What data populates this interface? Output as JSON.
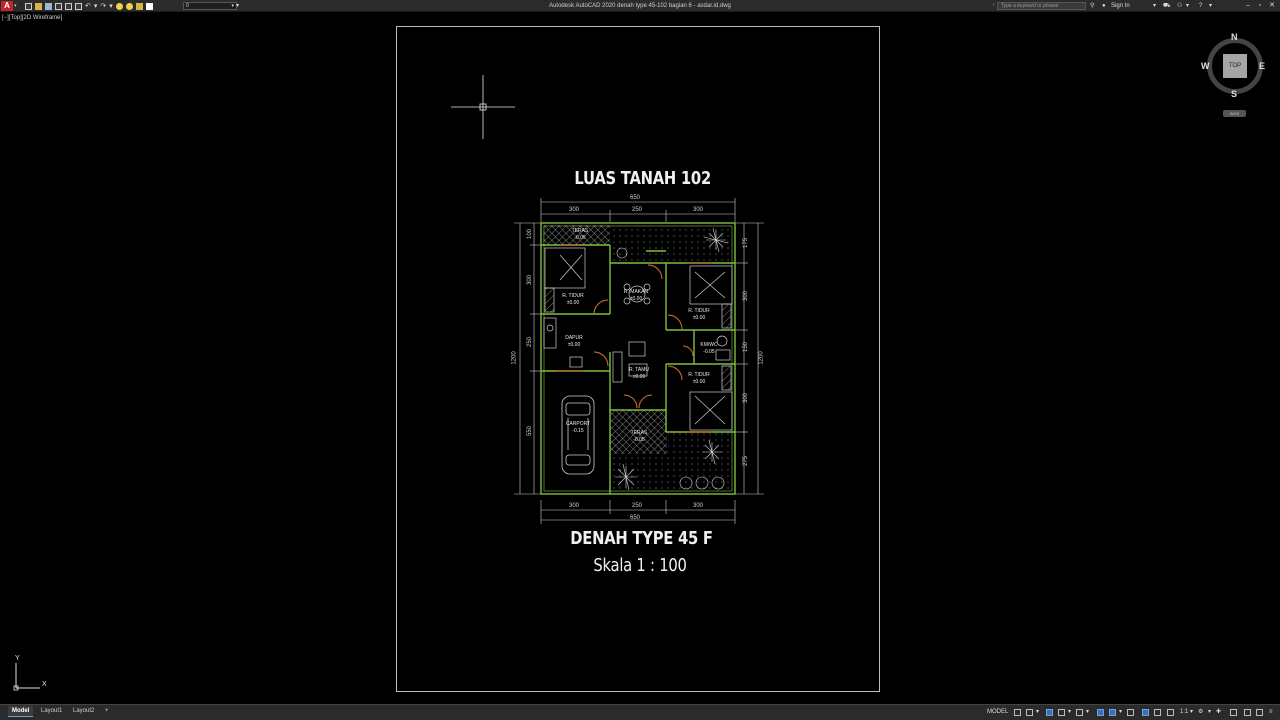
{
  "app": {
    "window_title": "Autodesk AutoCAD 2020    denah type 45-102 bagian 6 - asdar.id.dwg",
    "logo_letter": "A",
    "layer_combo": "0",
    "search_placeholder": "Type a keyword or phrase",
    "sign_in": "Sign In"
  },
  "viewport": {
    "label": "[−][Top][2D Wireframe]"
  },
  "drawing": {
    "top_title": "LUAS TANAH 102",
    "plan_title": "DENAH TYPE 45 F",
    "scale": "Skala 1 : 100",
    "dims_top_total": "650",
    "dims_top": [
      "300",
      "250",
      "300"
    ],
    "dims_bottom": [
      "300",
      "250",
      "300"
    ],
    "dims_bottom_total": "650",
    "dims_left": [
      "100",
      "300",
      "250",
      "550"
    ],
    "dims_left_total": "1200",
    "dims_right": [
      "175",
      "300",
      "150",
      "300",
      "275"
    ],
    "dims_right_total": "1200",
    "rooms": [
      {
        "name": "TERAS",
        "level": "-0.05"
      },
      {
        "name": "R. TIDUR",
        "level": "±0.00"
      },
      {
        "name": "R. MAKAN",
        "level": "±0.00"
      },
      {
        "name": "R. TIDUR",
        "level": "±0.00"
      },
      {
        "name": "DAPUR",
        "level": "±0.00"
      },
      {
        "name": "KM/WC",
        "level": "-0.05"
      },
      {
        "name": "R. TAMU",
        "level": "±0.00"
      },
      {
        "name": "R. TIDUR",
        "level": "±0.00"
      },
      {
        "name": "CARPORT",
        "level": "-0.15"
      },
      {
        "name": "TERAS",
        "level": "-0.05"
      }
    ]
  },
  "viewcube": {
    "top": "TOP",
    "north": "N",
    "south": "S",
    "east": "E",
    "west": "W",
    "wcs": "WCS"
  },
  "ucs": {
    "x": "X",
    "y": "Y"
  },
  "statusbar": {
    "tabs": [
      "Model",
      "Layout1",
      "Layout2"
    ],
    "add_tab": "+",
    "model_label": "MODEL",
    "scale": "1:1"
  },
  "colors": {
    "wall": "#7fbf3f",
    "dimension": "#d0d0d0",
    "door": "#d9722f",
    "hatch": "#d0d0d0"
  }
}
